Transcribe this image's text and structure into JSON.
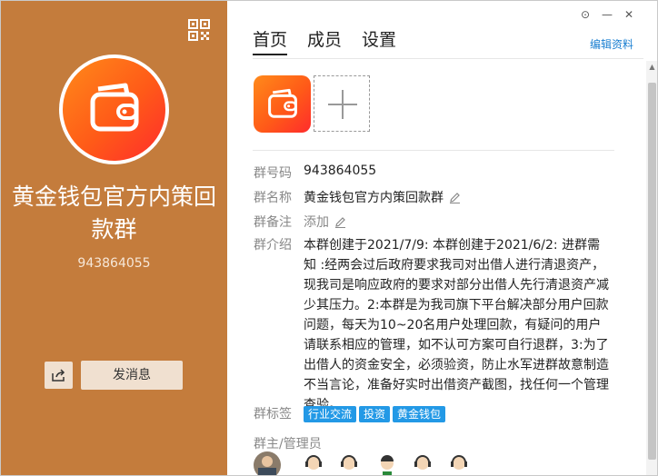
{
  "group": {
    "name": "黄金钱包官方内策回款群",
    "id": "943864055"
  },
  "left_panel": {
    "send_message_label": "发消息"
  },
  "tabs": [
    {
      "label": "首页",
      "active": true
    },
    {
      "label": "成员",
      "active": false
    },
    {
      "label": "设置",
      "active": false
    }
  ],
  "edit_profile_label": "编辑资料",
  "window_controls": {
    "pin": "⊙",
    "minimize": "—",
    "close": "✕"
  },
  "info": {
    "id_label": "群号码",
    "id_value": "943864055",
    "name_label": "群名称",
    "name_value": "黄金钱包官方内策回款群",
    "remark_label": "群备注",
    "remark_value": "添加",
    "intro_label": "群介绍",
    "intro_value": "本群创建于2021/7/9:  本群创建于2021/6/2:  进群需知 :经两会过后政府要求我司对出借人进行清退资产，现我司是响应政府的要求对部分出借人先行清退资产减少其压力。2:本群是为我司旗下平台解决部分用户回款问题，每天为10~20名用户处理回款，有疑问的用户请联系相应的管理，如不认可方案可自行退群，3:为了出借人的资金安全，必须验资，防止水军进群故意制造不当言论，准备好实时出借资产截图，找任何一个管理查验。",
    "tags_label": "群标签",
    "tags": [
      "行业交流",
      "投资",
      "黄金钱包"
    ],
    "admins_label": "群主/管理员"
  },
  "colors": {
    "left_bg": "#c47c3c",
    "accent_blue": "#1a7fd1",
    "tag_blue": "#2399e6",
    "logo_orange": "#ff6a1a"
  },
  "icons": [
    "qr-code-icon",
    "share-icon",
    "wallet-logo-icon",
    "plus-icon",
    "pencil-icon",
    "pin-icon",
    "minimize-icon",
    "close-icon"
  ]
}
